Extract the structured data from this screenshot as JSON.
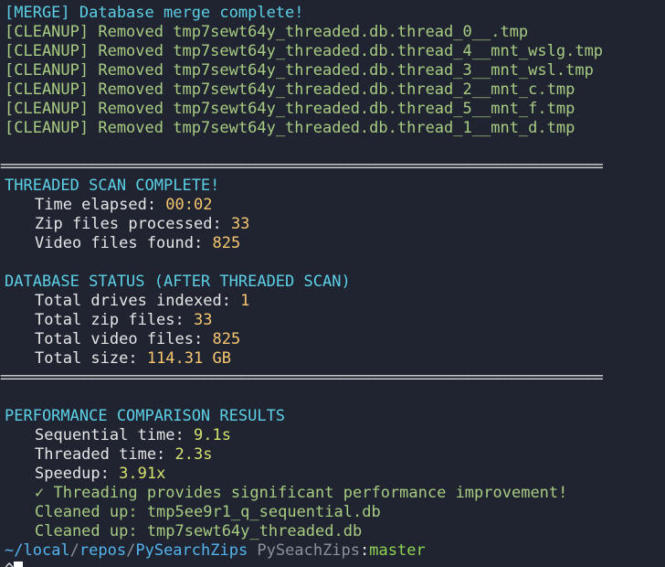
{
  "merge": {
    "line": "[MERGE] Database merge complete!"
  },
  "cleanup": [
    {
      "prefix": "[CLEANUP] Removed ",
      "file": "tmp7sewt64y_threaded.db.thread_0__.tmp"
    },
    {
      "prefix": "[CLEANUP] Removed ",
      "file": "tmp7sewt64y_threaded.db.thread_4__mnt_wslg.tmp"
    },
    {
      "prefix": "[CLEANUP] Removed ",
      "file": "tmp7sewt64y_threaded.db.thread_3__mnt_wsl.tmp"
    },
    {
      "prefix": "[CLEANUP] Removed ",
      "file": "tmp7sewt64y_threaded.db.thread_2__mnt_c.tmp"
    },
    {
      "prefix": "[CLEANUP] Removed ",
      "file": "tmp7sewt64y_threaded.db.thread_5__mnt_f.tmp"
    },
    {
      "prefix": "[CLEANUP] Removed ",
      "file": "tmp7sewt64y_threaded.db.thread_1__mnt_d.tmp"
    }
  ],
  "separator": "================================================================================",
  "threaded_scan": {
    "heading": "THREADED SCAN COMPLETE!",
    "rows": [
      {
        "label": "Time elapsed: ",
        "value": "00:02"
      },
      {
        "label": "Zip files processed: ",
        "value": "33"
      },
      {
        "label": "Video files found: ",
        "value": "825"
      }
    ]
  },
  "db_status": {
    "heading": "DATABASE STATUS (AFTER THREADED SCAN)",
    "rows": [
      {
        "label": "Total drives indexed: ",
        "value": "1"
      },
      {
        "label": "Total zip files: ",
        "value": "33"
      },
      {
        "label": "Total video files: ",
        "value": "825"
      },
      {
        "label": "Total size: ",
        "value": "114.31 GB"
      }
    ]
  },
  "performance": {
    "heading": "PERFORMANCE COMPARISON RESULTS",
    "rows": [
      {
        "label": "Sequential time: ",
        "value": "9.1s"
      },
      {
        "label": "Threaded time: ",
        "value": "2.3s"
      },
      {
        "label": "Speedup: ",
        "value": "3.91x"
      }
    ],
    "improvement": "✓ Threading provides significant performance improvement!",
    "cleaned": [
      "Cleaned up: tmp5ee9r1_q_sequential.db",
      "Cleaned up: tmp7sewt64y_threaded.db"
    ]
  },
  "prompt": {
    "tilde": "~/",
    "local": "local",
    "slash1": "/",
    "repos": "repos",
    "slash2": "/",
    "dir": "PySearchZips",
    "env": " PySeachZips",
    "colon": ":",
    "branch": "master",
    "caret": "^"
  },
  "colors": {
    "background": "#1f2430",
    "cyan_heading": "#5ccfe6",
    "green_log": "#a8cc82",
    "orange_value": "#f7c66f",
    "yellow_value": "#d5e26d",
    "path_blue": "#54b4ee",
    "branch_green": "#8fd454"
  }
}
